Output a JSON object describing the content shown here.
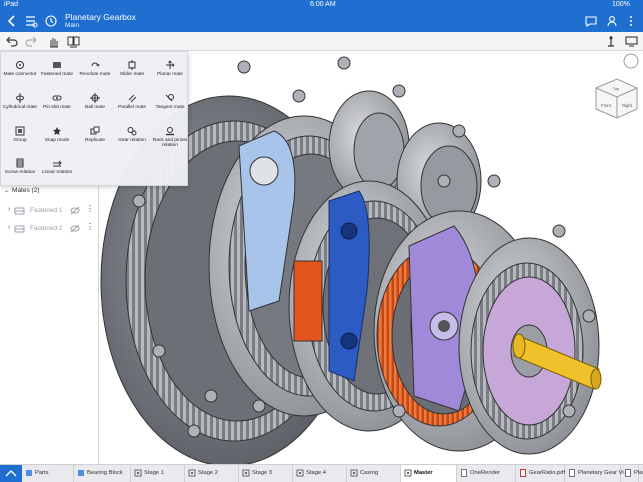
{
  "status_bar": {
    "carrier": "iPad",
    "time": "6:00 AM",
    "battery": "100%"
  },
  "header": {
    "title": "Planetary Gearbox",
    "subtitle": "Main"
  },
  "mate_flyout": {
    "items": [
      {
        "label": "Mate connector",
        "icon": "mate-connector-icon"
      },
      {
        "label": "Fastened mate",
        "icon": "fastened-mate-icon"
      },
      {
        "label": "Revolute mate",
        "icon": "revolute-mate-icon"
      },
      {
        "label": "Slider mate",
        "icon": "slider-mate-icon"
      },
      {
        "label": "Planar mate",
        "icon": "planar-mate-icon"
      },
      {
        "label": "Cylindrical mate",
        "icon": "cylindrical-mate-icon"
      },
      {
        "label": "Pin slot mate",
        "icon": "pin-slot-mate-icon"
      },
      {
        "label": "Ball mate",
        "icon": "ball-mate-icon"
      },
      {
        "label": "Parallel mate",
        "icon": "parallel-mate-icon"
      },
      {
        "label": "Tangent mate",
        "icon": "tangent-mate-icon"
      },
      {
        "label": "Group",
        "icon": "group-icon"
      },
      {
        "label": "Snap mode",
        "icon": "snap-mode-icon"
      },
      {
        "label": "Replicate",
        "icon": "replicate-icon"
      },
      {
        "label": "Gear relation",
        "icon": "gear-relation-icon"
      },
      {
        "label": "Rack and pinion relation",
        "icon": "rack-pinion-icon"
      },
      {
        "label": "Screw relation",
        "icon": "screw-relation-icon"
      },
      {
        "label": "Linear relation",
        "icon": "linear-relation-icon"
      }
    ]
  },
  "mates": {
    "heading": "Mates (2)",
    "items": [
      {
        "label": "Fastened 1"
      },
      {
        "label": "Fastened 2"
      }
    ]
  },
  "view_cube": {
    "front": "Front",
    "right": "Right",
    "top": "Top"
  },
  "tabs": [
    {
      "label": "Parts",
      "icon": "part-studio-icon",
      "active": false
    },
    {
      "label": "Bearing Block",
      "icon": "part-studio-icon",
      "active": false
    },
    {
      "label": "Stage 1",
      "icon": "assembly-icon",
      "active": false
    },
    {
      "label": "Stage 2",
      "icon": "assembly-icon",
      "active": false
    },
    {
      "label": "Stage 3",
      "icon": "assembly-icon",
      "active": false
    },
    {
      "label": "Stage 4",
      "icon": "assembly-icon",
      "active": false
    },
    {
      "label": "Casing",
      "icon": "assembly-icon",
      "active": false
    },
    {
      "label": "Master",
      "icon": "assembly-icon",
      "active": true
    },
    {
      "label": "OneRender",
      "icon": "document-icon",
      "active": false
    },
    {
      "label": "GearRatio.pdf",
      "icon": "pdf-icon",
      "active": false
    },
    {
      "label": "Planetary Gear Vi...",
      "icon": "document-icon",
      "active": false
    },
    {
      "label": "Plane",
      "icon": "document-icon",
      "active": false
    }
  ],
  "colors": {
    "accent": "#1f6fd1",
    "model_gray": "#8d9096",
    "model_blue": "#2c5bc4",
    "model_orange": "#e2561d",
    "model_purple": "#a089d8",
    "model_yellow": "#f0c12a"
  }
}
